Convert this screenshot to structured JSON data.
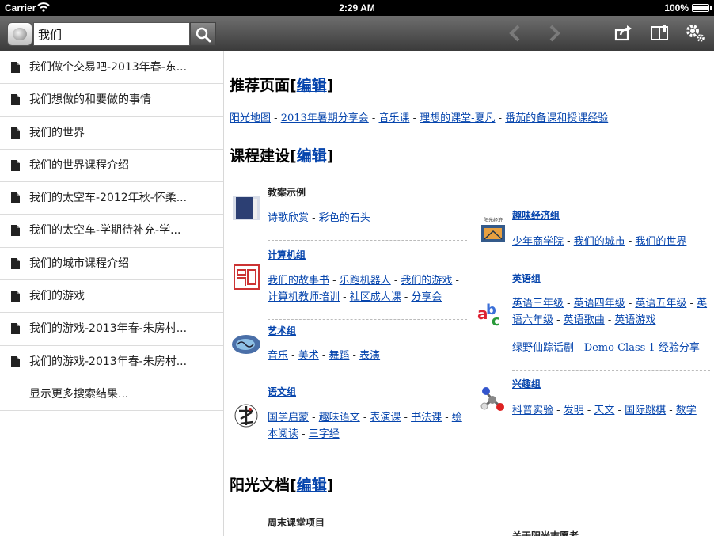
{
  "status": {
    "carrier": "Carrier",
    "time": "2:29 AM",
    "battery": "100%"
  },
  "search": {
    "value": "我们"
  },
  "sidebar": {
    "items": [
      {
        "label": "我们做个交易吧-2013年春-东..."
      },
      {
        "label": "我们想做的和要做的事情"
      },
      {
        "label": "我们的世界"
      },
      {
        "label": "我们的世界课程介绍"
      },
      {
        "label": "我们的太空车-2012年秋-怀柔..."
      },
      {
        "label": "我们的太空车-学期待补充-学..."
      },
      {
        "label": "我们的城市课程介绍"
      },
      {
        "label": "我们的游戏"
      },
      {
        "label": "我们的游戏-2013年春-朱房村..."
      },
      {
        "label": "我们的游戏-2013年春-朱房村..."
      }
    ],
    "more_label": "显示更多搜索结果..."
  },
  "content": {
    "edit_label": "编辑",
    "recommended": {
      "title": "推荐页面",
      "links": [
        "阳光地图",
        "2013年暑期分享会",
        "音乐课",
        "理想的课堂-夏凡",
        "番茄的备课和授课经验"
      ]
    },
    "courses": {
      "title": "课程建设",
      "groups": {
        "lesson": {
          "title": "教案示例",
          "links": [
            "诗歌欣赏",
            "彩色的石头"
          ]
        },
        "computer": {
          "title": "计算机组",
          "links": [
            "我们的故事书",
            "乐跑机器人",
            "我们的游戏",
            "计算机教师培训",
            "社区成人课",
            "分享会"
          ]
        },
        "art": {
          "title": "艺术组",
          "links": [
            "音乐",
            "美术",
            "舞蹈",
            "表演"
          ]
        },
        "chinese": {
          "title": "语文组",
          "links": [
            "国学启蒙",
            "趣味语文",
            "表演课",
            "书法课",
            "绘本阅读",
            "三字经"
          ]
        },
        "economics": {
          "title": "趣味经济组",
          "thumb_caption": "阳光经济",
          "links": [
            "少年商学院",
            "我们的城市",
            "我们的世界"
          ]
        },
        "english": {
          "title": "英语组",
          "links": [
            "英语三年级",
            "英语四年级",
            "英语五年级",
            "英语六年级",
            "英语歌曲",
            "英语游戏",
            "绿野仙踪话剧",
            "Demo Class 1 经验分享"
          ]
        },
        "interest": {
          "title": "兴趣组",
          "links": [
            "科普实验",
            "发明",
            "天文",
            "国际跳棋",
            "数学"
          ]
        }
      }
    },
    "docs": {
      "title": "阳光文档",
      "weekend": "周末课堂项目",
      "volunteer": "关于阳光志愿者"
    }
  },
  "colors": {
    "link": "#0645ad",
    "toolbar": "#4a4a4a"
  }
}
